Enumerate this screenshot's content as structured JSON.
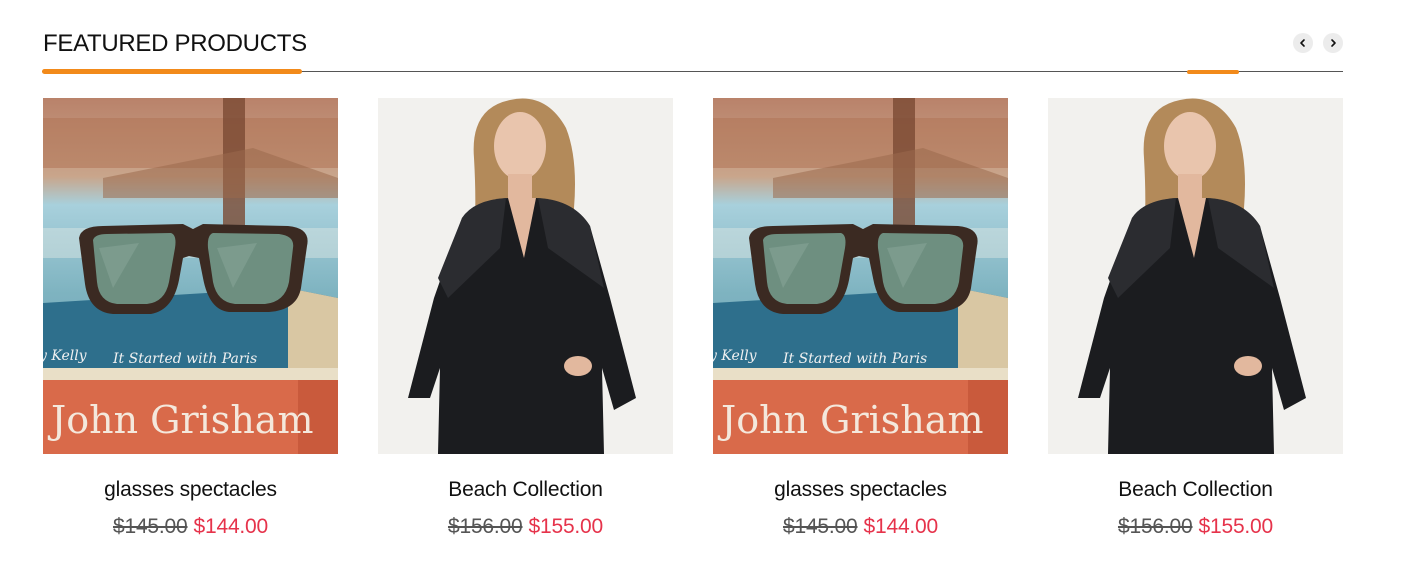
{
  "section": {
    "title": "FEATURED PRODUCTS",
    "accent_color": "#f28a1a",
    "prev_icon": "chevron-left-icon",
    "next_icon": "chevron-right-icon"
  },
  "products": [
    {
      "name": "glasses spectacles",
      "old_price": "$145.00",
      "new_price": "$144.00",
      "image": "sunglasses-on-books",
      "image_text": {
        "top": "It Started with Paris",
        "left": "y Kelly",
        "main": "John Grisham"
      }
    },
    {
      "name": "Beach Collection",
      "old_price": "$156.00",
      "new_price": "$155.00",
      "image": "woman-black-lace-blouse"
    },
    {
      "name": "glasses spectacles",
      "old_price": "$145.00",
      "new_price": "$144.00",
      "image": "sunglasses-on-books",
      "image_text": {
        "top": "It Started with Paris",
        "left": "y Kelly",
        "main": "John Grisham"
      }
    },
    {
      "name": "Beach Collection",
      "old_price": "$156.00",
      "new_price": "$155.00",
      "image": "woman-black-lace-blouse"
    }
  ],
  "colors": {
    "sale_price": "#e6334b",
    "old_price": "#555555"
  }
}
